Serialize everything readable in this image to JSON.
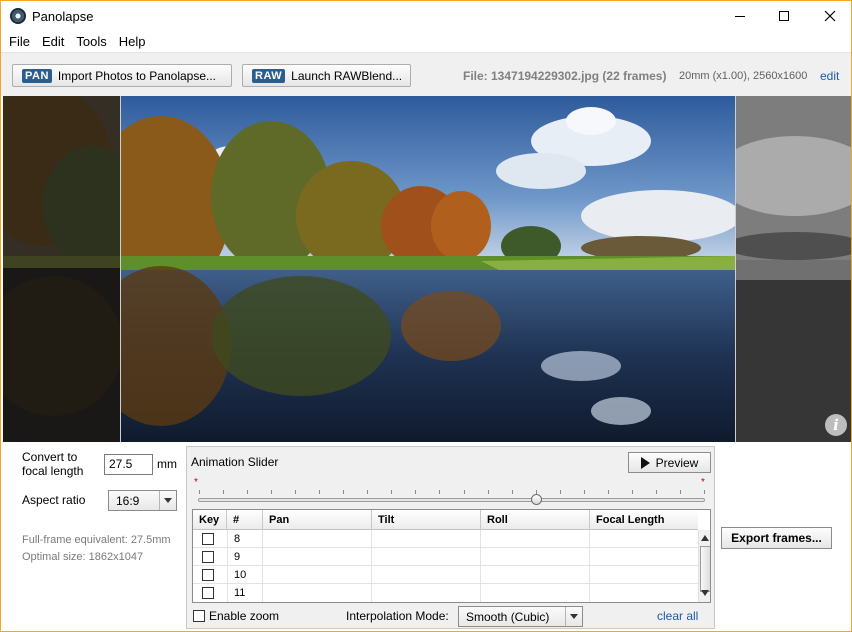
{
  "window": {
    "title": "Panolapse"
  },
  "menu": [
    "File",
    "Edit",
    "Tools",
    "Help"
  ],
  "toolbar": {
    "import": {
      "tag": "PAN",
      "label": "Import Photos to Panolapse..."
    },
    "raw": {
      "tag": "RAW",
      "label": "Launch RAWBlend..."
    },
    "file_info": "File: 1347194229302.jpg (22 frames)",
    "lens_info": "20mm (x1.00), 2560x1600",
    "edit_link": "edit"
  },
  "viewer": {
    "info_icon": "i"
  },
  "settings": {
    "convert_label_1": "Convert to",
    "convert_label_2": "focal length",
    "focal_value": "27.5",
    "focal_unit": "mm",
    "aspect_label": "Aspect ratio",
    "aspect_value": "16:9",
    "fullframe_text": "Full-frame equivalent: 27.5mm",
    "optimal_text": "Optimal size: 1862x1047"
  },
  "animation": {
    "title": "Animation Slider",
    "preview_label": "Preview",
    "slider_position": 0.67,
    "start_marker": "*",
    "end_marker": "*",
    "columns": [
      "Key",
      "#",
      "Pan",
      "Tilt",
      "Roll",
      "Focal Length"
    ],
    "rows": [
      {
        "key": false,
        "num": "8",
        "pan": "",
        "tilt": "",
        "roll": "",
        "focal": ""
      },
      {
        "key": false,
        "num": "9",
        "pan": "",
        "tilt": "",
        "roll": "",
        "focal": ""
      },
      {
        "key": false,
        "num": "10",
        "pan": "",
        "tilt": "",
        "roll": "",
        "focal": ""
      },
      {
        "key": false,
        "num": "11",
        "pan": "",
        "tilt": "",
        "roll": "",
        "focal": ""
      }
    ],
    "enable_zoom_label": "Enable zoom",
    "interp_label": "Interpolation Mode:",
    "interp_value": "Smooth (Cubic)",
    "clear_all": "clear all"
  },
  "export_label": "Export frames...",
  "colors": {
    "accent": "#2b5d8f",
    "link": "#1f5aa6",
    "marker": "#c00000"
  }
}
